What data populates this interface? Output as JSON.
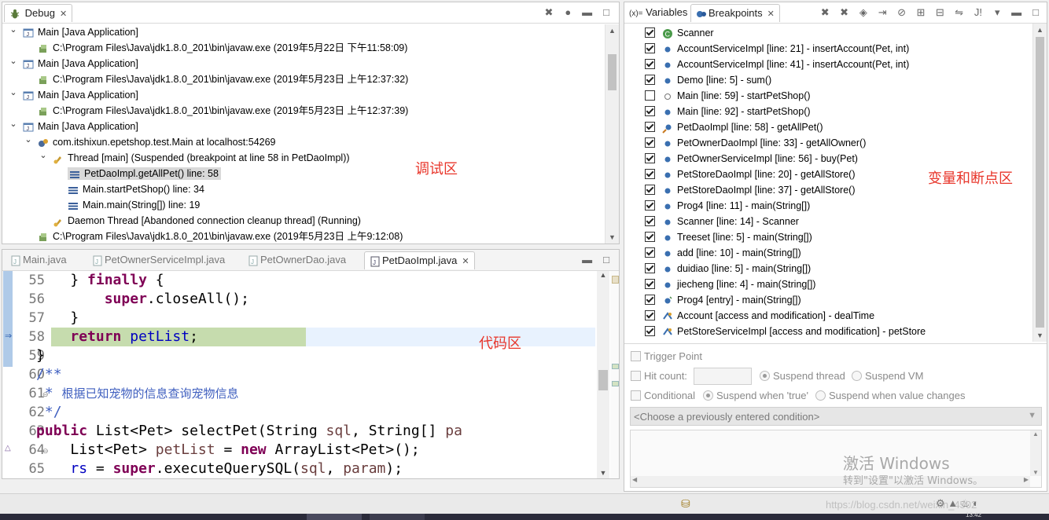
{
  "debug_view": {
    "tab_label": "Debug",
    "annotation": "调试区",
    "rows": [
      {
        "text": "Main [Java Application]"
      },
      {
        "text": "C:\\Program Files\\Java\\jdk1.8.0_201\\bin\\javaw.exe (2019年5月22日 下午11:58:09)"
      },
      {
        "text": "Main [Java Application]"
      },
      {
        "text": "C:\\Program Files\\Java\\jdk1.8.0_201\\bin\\javaw.exe (2019年5月23日 上午12:37:32)"
      },
      {
        "text": "Main [Java Application]"
      },
      {
        "text": "C:\\Program Files\\Java\\jdk1.8.0_201\\bin\\javaw.exe (2019年5月23日 上午12:37:39)"
      },
      {
        "text": "Main [Java Application]"
      },
      {
        "text": "com.itshixun.epetshop.test.Main at localhost:54269"
      },
      {
        "text": "Thread [main] (Suspended (breakpoint at line 58 in PetDaoImpl))"
      },
      {
        "text": "PetDaoImpl.getAllPet() line: 58"
      },
      {
        "text": "Main.startPetShop() line: 34"
      },
      {
        "text": "Main.main(String[]) line: 19"
      },
      {
        "text": "Daemon Thread [Abandoned connection cleanup thread] (Running)"
      },
      {
        "text": "C:\\Program Files\\Java\\jdk1.8.0_201\\bin\\javaw.exe (2019年5月23日 上午9:12:08)"
      }
    ]
  },
  "editor": {
    "tabs": [
      "Main.java",
      "PetOwnerServiceImpl.java",
      "PetOwnerDao.java",
      "PetDaoImpl.java"
    ],
    "active_tab": "PetDaoImpl.java",
    "annotation": "代码区",
    "line_numbers": [
      "55",
      "56",
      "57",
      "58",
      "59",
      "60",
      "61",
      "62",
      "63",
      "64",
      "65"
    ],
    "current_line": "58"
  },
  "right_view": {
    "tabs": {
      "variables": "Variables",
      "breakpoints": "Breakpoints"
    },
    "annotation": "变量和断点区",
    "breakpoints": [
      {
        "label": "Scanner",
        "checked": true
      },
      {
        "label": "AccountServiceImpl [line: 21] - insertAccount(Pet, int)",
        "checked": true
      },
      {
        "label": "AccountServiceImpl [line: 41] - insertAccount(Pet, int)",
        "checked": true
      },
      {
        "label": "Demo [line: 5] - sum()",
        "checked": true
      },
      {
        "label": "Main [line: 59] - startPetShop()",
        "checked": false
      },
      {
        "label": "Main [line: 92] - startPetShop()",
        "checked": true
      },
      {
        "label": "PetDaoImpl [line: 58] - getAllPet()",
        "checked": true
      },
      {
        "label": "PetOwnerDaoImpl [line: 33] - getAllOwner()",
        "checked": true
      },
      {
        "label": "PetOwnerServiceImpl [line: 56] - buy(Pet)",
        "checked": true
      },
      {
        "label": "PetStoreDaoImpl [line: 20] - getAllStore()",
        "checked": true
      },
      {
        "label": "PetStoreDaoImpl [line: 37] - getAllStore()",
        "checked": true
      },
      {
        "label": "Prog4 [line: 11] - main(String[])",
        "checked": true
      },
      {
        "label": "Scanner [line: 14] - Scanner",
        "checked": true
      },
      {
        "label": "Treeset [line: 5] - main(String[])",
        "checked": true
      },
      {
        "label": "add [line: 10] - main(String[])",
        "checked": true
      },
      {
        "label": "duidiao [line: 5] - main(String[])",
        "checked": true
      },
      {
        "label": "jiecheng [line: 4] - main(String[])",
        "checked": true
      },
      {
        "label": "Prog4 [entry] - main(String[])",
        "checked": true
      },
      {
        "label": "Account [access and modification] - dealTime",
        "checked": true
      },
      {
        "label": "PetStoreServiceImpl [access and modification] - petStore",
        "checked": true
      }
    ],
    "details": {
      "trigger_point": "Trigger Point",
      "hit_count": "Hit count:",
      "suspend_thread": "Suspend thread",
      "suspend_vm": "Suspend VM",
      "conditional": "Conditional",
      "suspend_true": "Suspend when 'true'",
      "suspend_changes": "Suspend when value changes",
      "condition_placeholder": "<Choose a previously entered condition>"
    }
  },
  "watermark": {
    "line1": "激活 Windows",
    "line2": "转到\"设置\"以激活 Windows。",
    "url": "https://blog.csdn.net/weixin_4502"
  },
  "taskbar": {
    "clock": "13:42"
  }
}
